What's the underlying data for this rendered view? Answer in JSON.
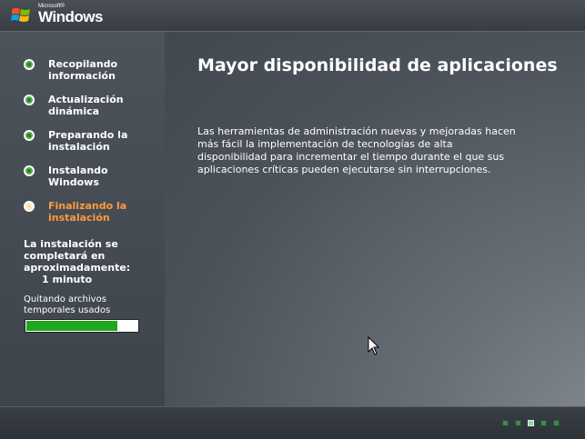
{
  "logo": {
    "brand_small": "Microsoft®",
    "brand": "Windows"
  },
  "sidebar": {
    "steps": [
      {
        "label": "Recopilando información",
        "state": "done"
      },
      {
        "label": "Actualización dinámica",
        "state": "done"
      },
      {
        "label": "Preparando la instalación",
        "state": "done"
      },
      {
        "label": "Instalando Windows",
        "state": "done"
      },
      {
        "label": "Finalizando la instalación",
        "state": "current"
      }
    ],
    "time_message_line1": "La instalación se completará en aproximadamente:",
    "time_message_line2": "1 minuto",
    "status_text": "Quitando archivos temporales usados",
    "progress_fraction": 0.82
  },
  "main": {
    "headline": "Mayor disponibilidad de aplicaciones",
    "body": "Las herramientas de administración nuevas y mejoradas hacen más fácil la implementación de tecnologías de alta disponibilidad para incrementar el tiempo durante el que sus aplicaciones críticas pueden ejecutarse sin interrupciones."
  },
  "slide_indicator": {
    "count": 5,
    "active_index": 2
  },
  "colors": {
    "done_dot": "#5aa94e",
    "current_label": "#ff9a3c",
    "progress_fill": "#1fa51f"
  }
}
